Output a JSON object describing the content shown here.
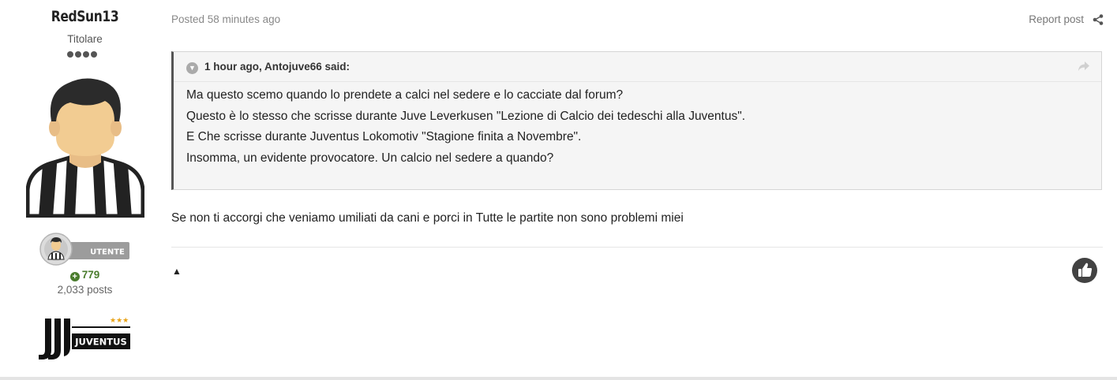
{
  "author": {
    "name": "RedSun13",
    "title": "Titolare",
    "rank_pips": 4,
    "badge_label": "UTENTE",
    "reputation": "779",
    "posts": "2,033 posts",
    "club": "JUVENTUS"
  },
  "post": {
    "posted": "Posted 58 minutes ago",
    "report_label": "Report post",
    "quote": {
      "citation": "1 hour ago, Antojuve66 said:",
      "lines": [
        "Ma questo scemo quando lo prendete a calci nel sedere e lo cacciate dal forum?",
        "Questo è lo stesso che scrisse durante Juve Leverkusen \"Lezione di Calcio dei tedeschi alla Juventus\".",
        "E Che scrisse durante Juventus Lokomotiv \"Stagione finita a Novembre\".",
        "Insomma, un evidente provocatore. Un calcio nel sedere a quando?"
      ]
    },
    "text": "Se non ti accorgi che veniamo umiliati da cani e porci in Tutte le partite non sono problemi miei",
    "up_arrow": "▲"
  },
  "colors": {
    "reputation": "#4a7c2d",
    "like_button": "#424242",
    "quote_border": "#555555"
  },
  "icons": {
    "share": "share-icon",
    "like": "thumbs-up-icon",
    "quote_toggle": "chevron-down-icon",
    "quote_goto": "share-arrow-icon"
  }
}
